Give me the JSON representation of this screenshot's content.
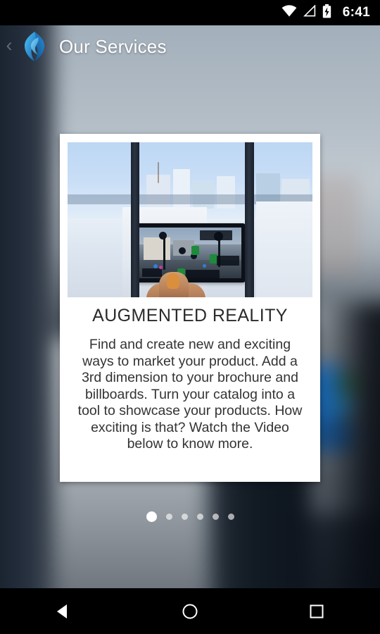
{
  "status_bar": {
    "time": "6:41",
    "icons": [
      "wifi-icon",
      "cellular-signal-icon",
      "battery-charging-icon"
    ]
  },
  "app_bar": {
    "back_label": "‹",
    "logo_name": "app-logo-diamond",
    "title": "Our Services",
    "title_color": "#ffffff"
  },
  "card": {
    "image_name": "augmented-reality-photo",
    "image_alt": "Hand holding a smartphone showing an augmented reality city street view through an office window",
    "title": "AUGMENTED REALITY",
    "body": "Find and create new and exciting ways to market your product. Add a 3rd dimension to your brochure and billboards.  Turn your catalog into a tool to showcase your products. How exciting is that?  Watch the Video below to know more.",
    "background": "#ffffff",
    "title_color": "#2b2b2b",
    "body_color": "#333333"
  },
  "pager": {
    "total": 6,
    "active_index": 0,
    "active_color": "#ffffff",
    "inactive_color": "rgba(255,255,255,0.62)"
  },
  "nav_bar": {
    "buttons": [
      {
        "name": "back-button",
        "glyph": "◁"
      },
      {
        "name": "home-button",
        "glyph": "○"
      },
      {
        "name": "recents-button",
        "glyph": "□"
      }
    ]
  },
  "theme": {
    "accent": "#1f7fc4",
    "status_bar_bg": "#000000",
    "nav_bar_bg": "#000000"
  }
}
